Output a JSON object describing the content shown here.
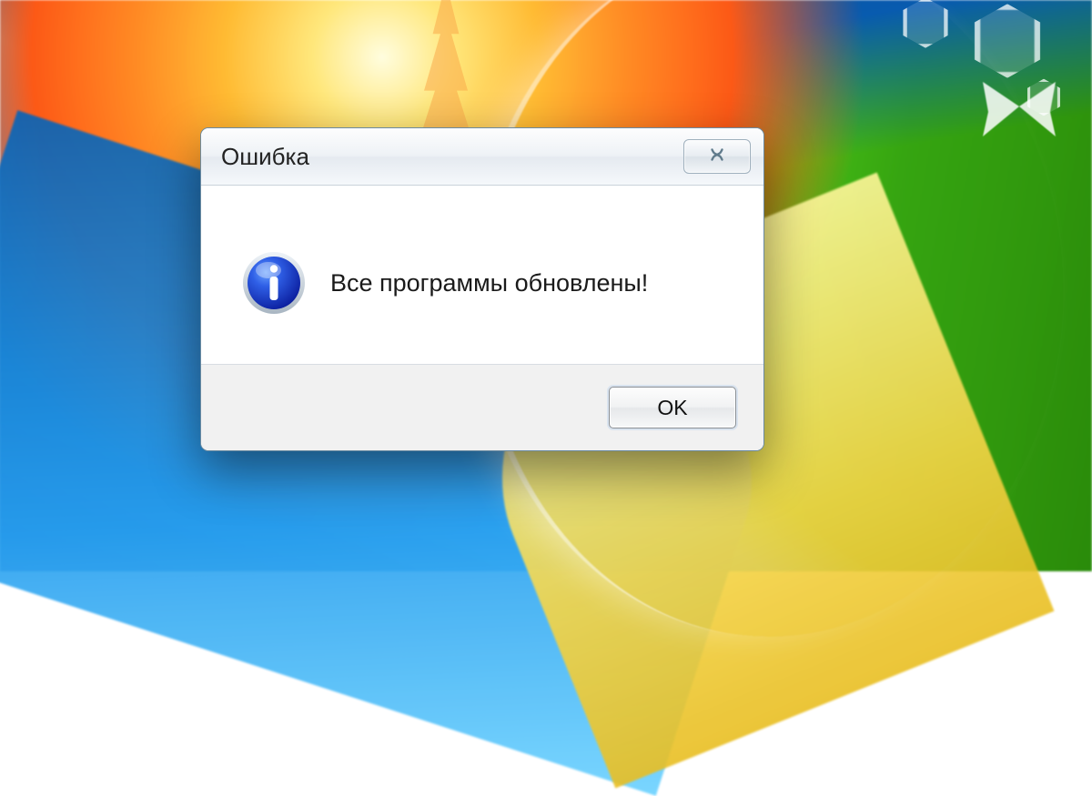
{
  "dialog": {
    "title": "Ошибка",
    "message": "Все программы обновлены!",
    "ok_label": "OK",
    "icon": "info-icon",
    "close_icon": "close-icon"
  }
}
